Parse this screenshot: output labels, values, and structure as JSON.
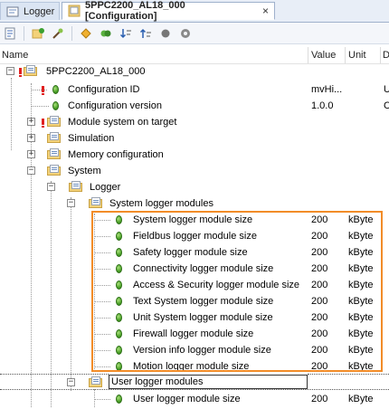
{
  "tabs": [
    {
      "label": "Logger",
      "active": false
    },
    {
      "label": "5PPC2200_AL18_000 [Configuration]",
      "active": true,
      "close": "×"
    }
  ],
  "toolbar": {
    "buttons": [
      "properties-icon",
      "add-icon",
      "wizard-icon",
      "navigate-icon",
      "expand-icon",
      "sort-down-icon",
      "sort-up-icon",
      "circle-icon",
      "gear-icon"
    ]
  },
  "columns": {
    "name": "Name",
    "value": "Value",
    "unit": "Unit",
    "desc": "D"
  },
  "tree": {
    "root": {
      "label": "5PPC2200_AL18_000"
    },
    "config_id": {
      "label": "Configuration ID",
      "value": "mvHi...",
      "desc": "U"
    },
    "config_version": {
      "label": "Configuration version",
      "value": "1.0.0",
      "desc": "C"
    },
    "module_system": {
      "label": "Module system on target"
    },
    "simulation": {
      "label": "Simulation"
    },
    "memory": {
      "label": "Memory configuration"
    },
    "system": {
      "label": "System"
    },
    "logger": {
      "label": "Logger"
    },
    "system_logger_modules": {
      "label": "System logger modules"
    },
    "system_items": [
      {
        "label": "System logger module size",
        "value": "200",
        "unit": "kByte"
      },
      {
        "label": "Fieldbus logger module size",
        "value": "200",
        "unit": "kByte"
      },
      {
        "label": "Safety logger module size",
        "value": "200",
        "unit": "kByte"
      },
      {
        "label": "Connectivity logger module size",
        "value": "200",
        "unit": "kByte"
      },
      {
        "label": "Access & Security logger module size",
        "value": "200",
        "unit": "kByte"
      },
      {
        "label": "Text System logger module size",
        "value": "200",
        "unit": "kByte"
      },
      {
        "label": "Unit System logger module size",
        "value": "200",
        "unit": "kByte"
      },
      {
        "label": "Firewall logger module size",
        "value": "200",
        "unit": "kByte"
      },
      {
        "label": "Version info logger module size",
        "value": "200",
        "unit": "kByte"
      },
      {
        "label": "Motion logger module size",
        "value": "200",
        "unit": "kByte"
      }
    ],
    "user_logger_modules": {
      "label": "User logger modules"
    },
    "user_items": [
      {
        "label": "User logger module size",
        "value": "200",
        "unit": "kByte"
      }
    ]
  },
  "colors": {
    "highlight": "#f28c28",
    "green": "#4ea42a",
    "warning": "#e02020"
  }
}
